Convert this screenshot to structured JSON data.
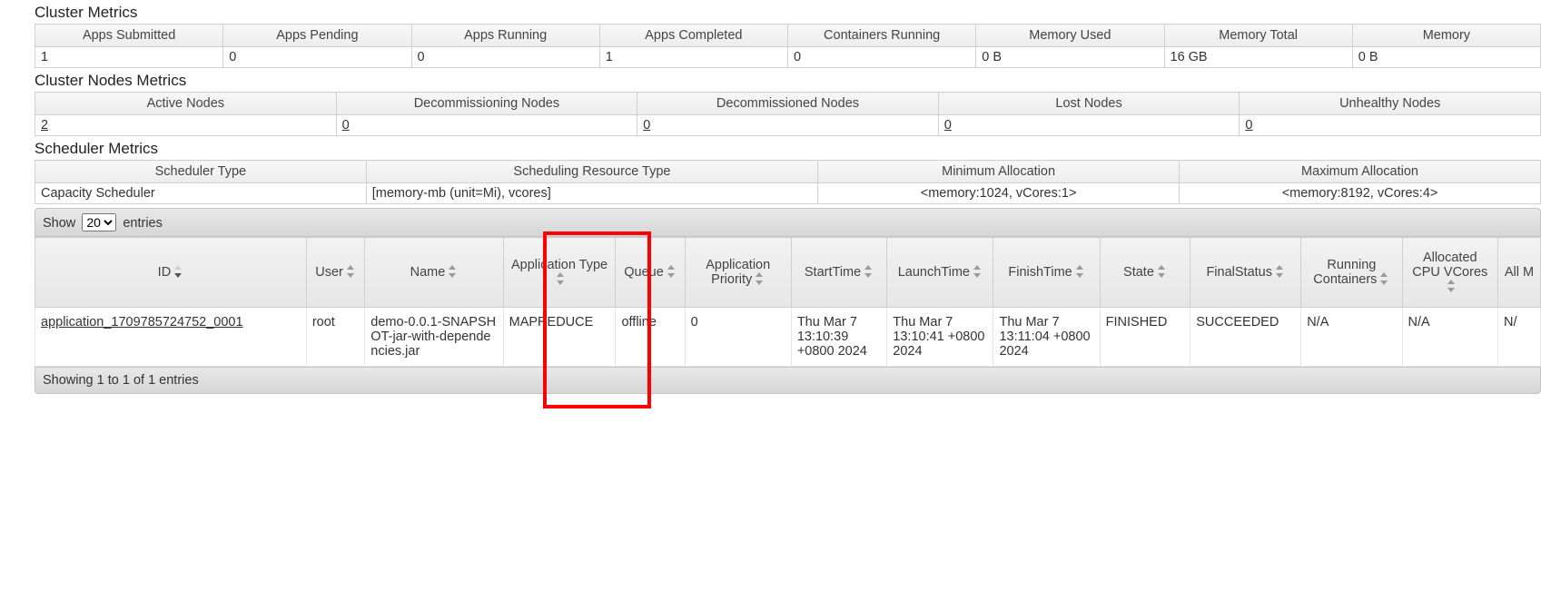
{
  "sections": {
    "cluster_metrics": "Cluster Metrics",
    "cluster_nodes_metrics": "Cluster Nodes Metrics",
    "scheduler_metrics": "Scheduler Metrics"
  },
  "cluster_metrics_headers": [
    "Apps Submitted",
    "Apps Pending",
    "Apps Running",
    "Apps Completed",
    "Containers Running",
    "Memory Used",
    "Memory Total",
    "Memory"
  ],
  "cluster_metrics_values": [
    "1",
    "0",
    "0",
    "1",
    "0",
    "0 B",
    "16 GB",
    "0 B"
  ],
  "nodes_headers": [
    "Active Nodes",
    "Decommissioning Nodes",
    "Decommissioned Nodes",
    "Lost Nodes",
    "Unhealthy Nodes"
  ],
  "nodes_values": [
    "2",
    "0",
    "0",
    "0",
    "0"
  ],
  "scheduler_headers": [
    "Scheduler Type",
    "Scheduling Resource Type",
    "Minimum Allocation",
    "Maximum Allocation"
  ],
  "scheduler_values": [
    "Capacity Scheduler",
    "[memory-mb (unit=Mi), vcores]",
    "<memory:1024, vCores:1>",
    "<memory:8192, vCores:4>"
  ],
  "toolbar": {
    "show": "Show",
    "entries": "entries",
    "page_size": "20"
  },
  "apps_headers": [
    "ID",
    "User",
    "Name",
    "Application Type",
    "Queue",
    "Application Priority",
    "StartTime",
    "LaunchTime",
    "FinishTime",
    "State",
    "FinalStatus",
    "Running Containers",
    "Allocated CPU VCores",
    "All M"
  ],
  "apps_row": {
    "id": "application_1709785724752_0001",
    "user": "root",
    "name": "demo-0.0.1-SNAPSHOT-jar-with-dependencies.jar",
    "app_type": "MAPREDUCE",
    "queue": "offline",
    "priority": "0",
    "start_time": "Thu Mar 7 13:10:39 +0800 2024",
    "launch_time": "Thu Mar 7 13:10:41 +0800 2024",
    "finish_time": "Thu Mar 7 13:11:04 +0800 2024",
    "state": "FINISHED",
    "final_status": "SUCCEEDED",
    "running_containers": "N/A",
    "alloc_cpu": "N/A",
    "all_m": "N/"
  },
  "footer": "Showing 1 to 1 of 1 entries"
}
